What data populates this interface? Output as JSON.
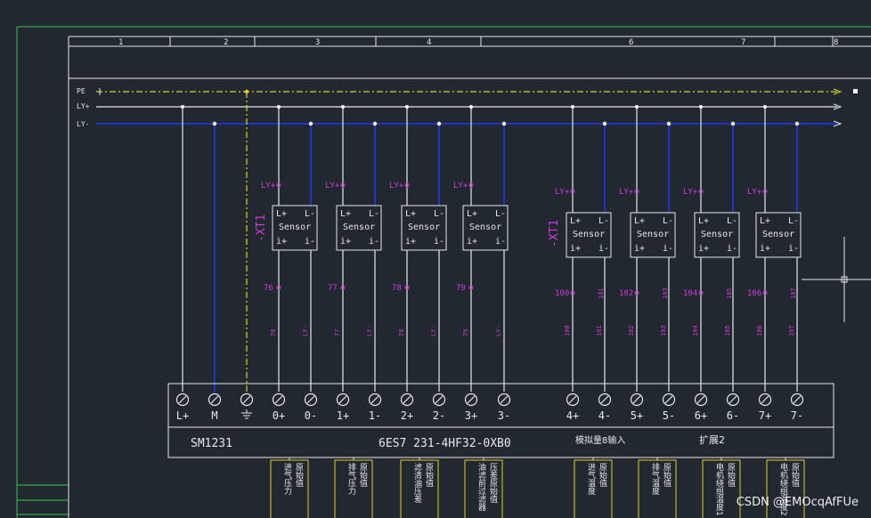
{
  "colors": {
    "background": "#212830",
    "frame_green": "#35c94a",
    "wire_white": "#e6e8ea",
    "wire_blue": "#1e33c8",
    "pe_yellow": "#d9d22a",
    "magenta": "#d23ad8",
    "label_box_yellow": "#d9d22a"
  },
  "ruler": [
    "1",
    "2",
    "3",
    "4",
    "6",
    "7",
    "8"
  ],
  "bus": {
    "pe": "PE",
    "ly_plus": "LY+",
    "ly_minus": "LY-"
  },
  "xt_labels": [
    "-XT1",
    "-XT1"
  ],
  "sensor": {
    "title": "Sensor",
    "lp": "L+",
    "lm": "L-",
    "ip": "i+",
    "im": "i-",
    "ly_tag": "LY+"
  },
  "terminal_numbers_left": [
    "76",
    "77",
    "78",
    "79"
  ],
  "terminal_numbers_right": [
    "100",
    "101",
    "102",
    "103",
    "104",
    "105",
    "106",
    "107"
  ],
  "wire_numbers_left": [
    "76",
    "LY-",
    "77",
    "LY-",
    "78",
    "LY-",
    "79",
    "LY-"
  ],
  "wire_numbers_right": [
    "100",
    "101",
    "102",
    "103",
    "104",
    "105",
    "106",
    "107"
  ],
  "module": {
    "terminals": [
      "L+",
      "M",
      "⏚",
      "0+",
      "0-",
      "1+",
      "1-",
      "2+",
      "2-",
      "3+",
      "3-",
      "4+",
      "4-",
      "5+",
      "5-",
      "6+",
      "6-",
      "7+",
      "7-"
    ],
    "name": "SM1231",
    "part_number": "6ES7 231-4HF32-0XB0",
    "desc": "模拟量8输入",
    "ext": "扩展2"
  },
  "signal_labels": [
    {
      "l1": "进气压力",
      "l2": "原始值"
    },
    {
      "l1": "排气压力",
      "l2": "原始值"
    },
    {
      "l1": "滤清油压差",
      "l2": "原始值"
    },
    {
      "l1": "油滤前过滤器",
      "l2": "压差原始值"
    },
    {
      "l1": "进气温度",
      "l2": "原始值"
    },
    {
      "l1": "排气温度",
      "l2": "原始值"
    },
    {
      "l1": "电机绕组温度1",
      "l2": "原始值"
    },
    {
      "l1": "电机绕组温度2",
      "l2": "原始值"
    }
  ],
  "watermark": "CSDN @EMOcqAfFUe"
}
